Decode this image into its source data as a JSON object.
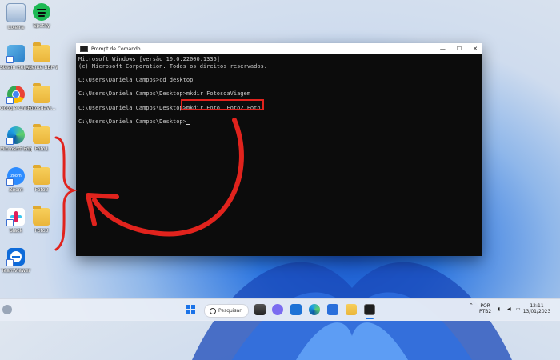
{
  "desktop": {
    "icons": [
      {
        "label": "Lixeira"
      },
      {
        "label": "Spotify"
      },
      {
        "label": "Steam Helpdesk"
      },
      {
        "label": "Agente BBP Windows e..."
      },
      {
        "label": "Google Chrome"
      },
      {
        "label": "FotosdaVi..."
      },
      {
        "label": "Microsoft Edge"
      },
      {
        "label": "Foto1"
      },
      {
        "label": "Zoom"
      },
      {
        "label": "Foto2"
      },
      {
        "label": "Slack"
      },
      {
        "label": "Foto3"
      },
      {
        "label": "TeamViewer"
      }
    ]
  },
  "cmd": {
    "title": "Prompt de Comando",
    "lines": [
      "Microsoft Windows [versão 10.0.22000.1335]",
      "(c) Microsoft Corporation. Todos os direitos reservados.",
      "",
      "C:\\Users\\Daniela Campos>cd desktop",
      "",
      "C:\\Users\\Daniela Campos\\Desktop>mkdir FotosdaViagem",
      "",
      "C:\\Users\\Daniela Campos\\Desktop>mkdir Foto1 Foto2 Foto3",
      "",
      "C:\\Users\\Daniela Campos\\Desktop>"
    ],
    "controls": {
      "minimize": "—",
      "maximize": "☐",
      "close": "✕"
    }
  },
  "taskbar": {
    "search_label": "Pesquisar",
    "language": "POR",
    "keyboard": "PTB2",
    "time": "12:11",
    "date": "13/01/2023"
  },
  "colors": {
    "annotation_red": "#e1231d",
    "terminal_bg": "#0c0c0c",
    "terminal_text": "#cccccc"
  }
}
